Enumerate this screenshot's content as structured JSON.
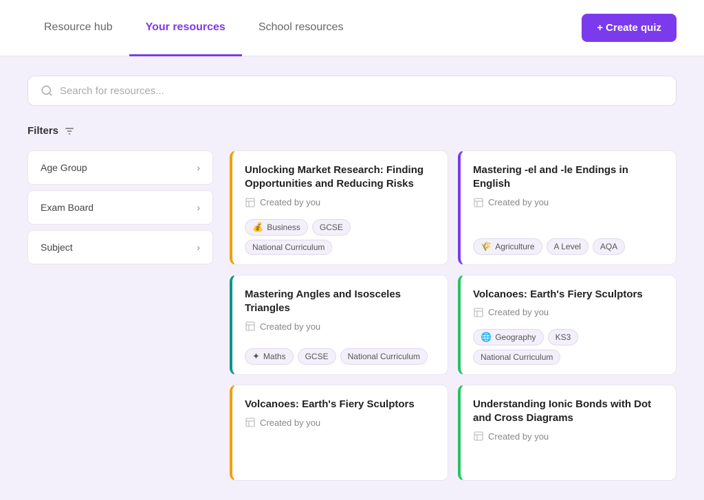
{
  "nav": {
    "tabs": [
      {
        "id": "resource-hub",
        "label": "Resource hub",
        "active": false
      },
      {
        "id": "your-resources",
        "label": "Your resources",
        "active": true
      },
      {
        "id": "school-resources",
        "label": "School resources",
        "active": false
      }
    ],
    "create_quiz_label": "+ Create quiz"
  },
  "search": {
    "placeholder": "Search for resources..."
  },
  "filters": {
    "label": "Filters",
    "items": [
      {
        "id": "age-group",
        "label": "Age Group"
      },
      {
        "id": "exam-board",
        "label": "Exam Board"
      },
      {
        "id": "subject",
        "label": "Subject"
      }
    ]
  },
  "cards": [
    {
      "id": "card-1",
      "title": "Unlocking Market Research: Finding Opportunities and Reducing Risks",
      "creator": "Created by you",
      "border_color": "border-yellow",
      "tags": [
        {
          "label": "Business",
          "icon": "💰"
        },
        {
          "label": "GCSE",
          "icon": null
        },
        {
          "label": "National Curriculum",
          "icon": null
        }
      ]
    },
    {
      "id": "card-2",
      "title": "Mastering -el and -le Endings in English",
      "creator": "Created by you",
      "border_color": "border-purple",
      "tags": [
        {
          "label": "Agriculture",
          "icon": "🌾"
        },
        {
          "label": "A Level",
          "icon": null
        },
        {
          "label": "AQA",
          "icon": null
        }
      ]
    },
    {
      "id": "card-3",
      "title": "Mastering Angles and Isosceles Triangles",
      "creator": "Created by you",
      "border_color": "border-teal",
      "tags": [
        {
          "label": "Maths",
          "icon": "✦"
        },
        {
          "label": "GCSE",
          "icon": null
        },
        {
          "label": "National Curriculum",
          "icon": null
        }
      ]
    },
    {
      "id": "card-4",
      "title": "Volcanoes: Earth's Fiery Sculptors",
      "creator": "Created by you",
      "border_color": "border-green",
      "tags": [
        {
          "label": "Geography",
          "icon": "🌐"
        },
        {
          "label": "KS3",
          "icon": null
        },
        {
          "label": "National Curriculum",
          "icon": null
        }
      ]
    },
    {
      "id": "card-5",
      "title": "Volcanoes: Earth's Fiery Sculptors",
      "creator": "Created by you",
      "border_color": "border-yellow",
      "tags": []
    },
    {
      "id": "card-6",
      "title": "Understanding Ionic Bonds with Dot and Cross Diagrams",
      "creator": "Created by you",
      "border_color": "border-green",
      "tags": []
    }
  ]
}
